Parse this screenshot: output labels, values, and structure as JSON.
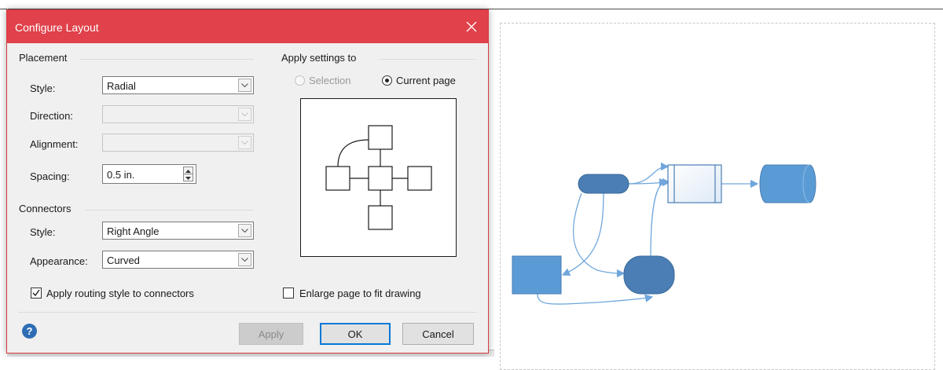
{
  "dialog": {
    "title": "Configure Layout",
    "close_icon": "close-icon"
  },
  "placement": {
    "group_label": "Placement",
    "style_label": "Style:",
    "style_value": "Radial",
    "direction_label": "Direction:",
    "direction_value": "",
    "direction_enabled": false,
    "alignment_label": "Alignment:",
    "alignment_value": "",
    "alignment_enabled": false,
    "spacing_label": "Spacing:",
    "spacing_value": "0.5 in."
  },
  "connectors": {
    "group_label": "Connectors",
    "style_label": "Style:",
    "style_value": "Right Angle",
    "appearance_label": "Appearance:",
    "appearance_value": "Curved",
    "apply_routing_label": "Apply routing style to connectors",
    "apply_routing_checked": true
  },
  "apply_settings": {
    "group_label": "Apply settings to",
    "selection_label": "Selection",
    "selection_enabled": false,
    "current_page_label": "Current page",
    "selected": "current_page"
  },
  "enlarge_page": {
    "label": "Enlarge page to fit drawing",
    "checked": false
  },
  "buttons": {
    "apply": "Apply",
    "apply_enabled": false,
    "ok": "OK",
    "cancel": "Cancel",
    "help_icon": "help-icon",
    "help_glyph": "?"
  },
  "colors": {
    "titlebar": "#e0414a",
    "shape_blue": "#5b9bd5",
    "shape_dark_blue": "#4a7eb5",
    "connector_blue": "#6fa6dc"
  }
}
